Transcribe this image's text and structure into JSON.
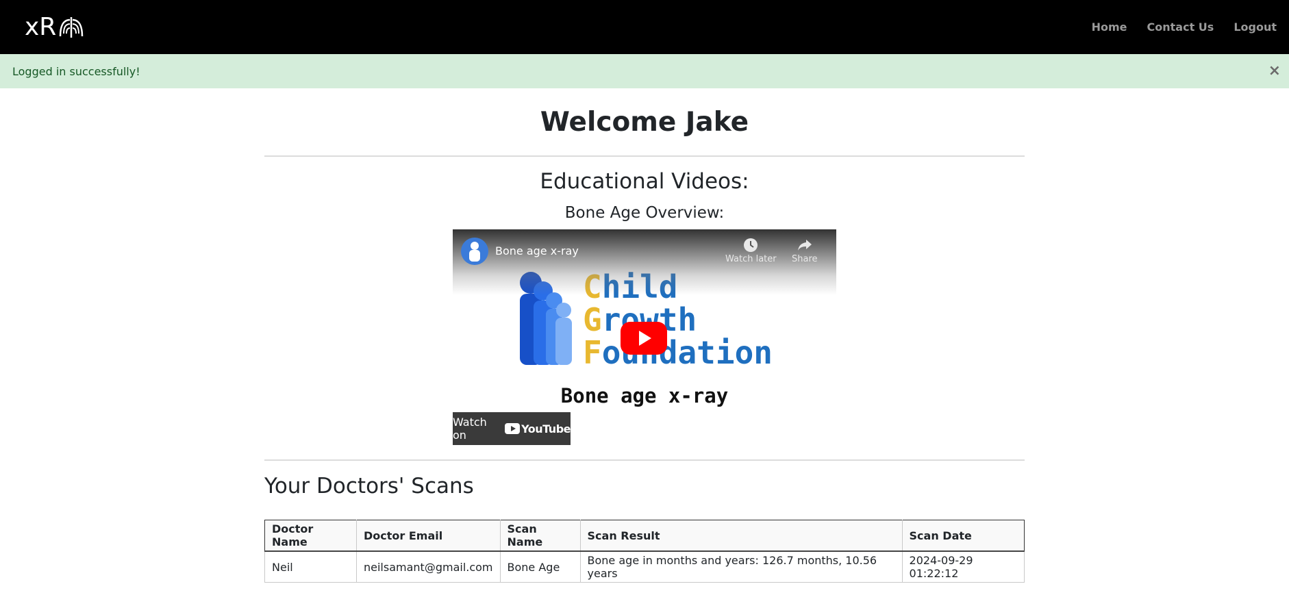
{
  "navbar": {
    "brand": "xR",
    "links": {
      "home": "Home",
      "contact": "Contact Us",
      "logout": "Logout"
    }
  },
  "alert": {
    "message": "Logged in successfully!",
    "close": "×"
  },
  "main": {
    "welcome": "Welcome Jake",
    "edu_title": "Educational Videos:",
    "video_section_title": "Bone Age Overview:",
    "video": {
      "title": "Bone age x-ray",
      "watch_later": "Watch later",
      "share": "Share",
      "logo_line1_first": "C",
      "logo_line1_rest": "hild",
      "logo_line2_first": "G",
      "logo_line2_rest": "rowth",
      "logo_line3_first": "F",
      "logo_line3_rest": "oundation",
      "caption": "Bone age x-ray",
      "watch_on": "Watch on",
      "youtube": "YouTube"
    },
    "scans_title": "Your Doctors' Scans",
    "table": {
      "headers": [
        "Doctor Name",
        "Doctor Email",
        "Scan Name",
        "Scan Result",
        "Scan Date"
      ],
      "rows": [
        [
          "Neil",
          "neilsamant@gmail.com",
          "Bone Age",
          "Bone age in months and years: 126.7 months, 10.56 years",
          "2024-09-29 01:22:12"
        ]
      ]
    }
  },
  "colors": {
    "navbar_bg": "#000000",
    "alert_bg": "#d4edda",
    "alert_text": "#155724",
    "play_button": "#ff0000"
  }
}
